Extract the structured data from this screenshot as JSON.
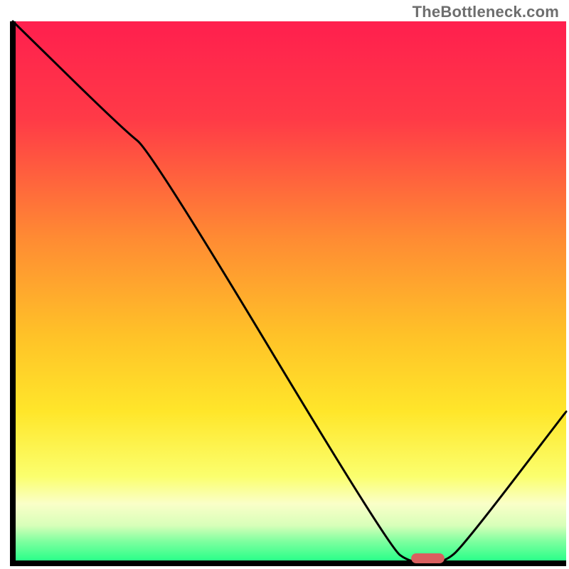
{
  "attribution": "TheBottleneck.com",
  "chart_data": {
    "type": "line",
    "title": "",
    "xlabel": "",
    "ylabel": "",
    "xlim": [
      0,
      100
    ],
    "ylim": [
      0,
      100
    ],
    "series": [
      {
        "name": "bottleneck-curve",
        "x": [
          0,
          20,
          25,
          68,
          72,
          78,
          82,
          100
        ],
        "values": [
          100,
          80,
          76,
          3,
          0,
          0,
          4,
          28
        ]
      }
    ],
    "marker": {
      "name": "optimal-range",
      "x_start": 72,
      "x_end": 78,
      "y": 0,
      "color": "#d95f5f"
    },
    "gradient_stops": [
      {
        "offset": 0,
        "color": "#ff1f4e"
      },
      {
        "offset": 18,
        "color": "#ff3a47"
      },
      {
        "offset": 40,
        "color": "#ff8b33"
      },
      {
        "offset": 58,
        "color": "#ffc228"
      },
      {
        "offset": 72,
        "color": "#ffe62a"
      },
      {
        "offset": 84,
        "color": "#fbff6e"
      },
      {
        "offset": 89,
        "color": "#faffc8"
      },
      {
        "offset": 93,
        "color": "#d8ffb9"
      },
      {
        "offset": 96,
        "color": "#7dff9f"
      },
      {
        "offset": 100,
        "color": "#1eff86"
      }
    ],
    "axis_color": "#000000",
    "curve_color": "#000000",
    "curve_width": 3
  }
}
